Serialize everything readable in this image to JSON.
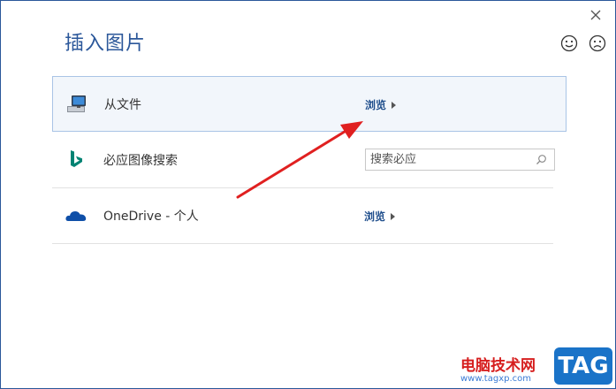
{
  "dialog": {
    "title": "插入图片"
  },
  "rows": [
    {
      "label": "从文件",
      "action": "浏览",
      "icon": "computer-icon"
    },
    {
      "label": "必应图像搜索",
      "search_placeholder": "搜索必应",
      "icon": "bing-icon"
    },
    {
      "label": "OneDrive - 个人",
      "action": "浏览",
      "icon": "onedrive-icon"
    }
  ],
  "colors": {
    "accent": "#2b579a",
    "selected_bg": "#f2f6fb",
    "arrow": "#e02020",
    "bing": "#008373",
    "onedrive": "#0f4fa8"
  },
  "watermark": {
    "site_name": "电脑技术网",
    "url": "www.tagxp.com",
    "tag": "TAG"
  }
}
